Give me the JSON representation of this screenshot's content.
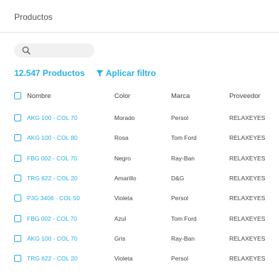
{
  "header": {
    "title": "Productos"
  },
  "search": {
    "placeholder": "",
    "value": ""
  },
  "summary": {
    "count_label": "12.547 Productos",
    "filter_label": "Aplicar filtro"
  },
  "table": {
    "columns": [
      "Nombre",
      "Color",
      "Marca",
      "Proveedor"
    ],
    "rows": [
      {
        "name": "AKG 100 - COL 70",
        "color": "Morado",
        "brand": "Persol",
        "supplier": "RELAXEYES"
      },
      {
        "name": "AKG 100 - COL 80",
        "color": "Rosa",
        "brand": "Tom Ford",
        "supplier": "RELAXEYES"
      },
      {
        "name": "FBG 002 - COL 70",
        "color": "Negro",
        "brand": "Ray-Ban",
        "supplier": "RELAXEYES"
      },
      {
        "name": "TRG 622 - COL 20",
        "color": "Amarillo",
        "brand": "D&G",
        "supplier": "RELAXEYES"
      },
      {
        "name": "PJG  3406 - COL 50",
        "color": "Violeta",
        "brand": "Persol",
        "supplier": "RELAXEYES"
      },
      {
        "name": "FBG 002 - COL 70",
        "color": "Azul",
        "brand": "Tom Ford",
        "supplier": "RELAXEYES"
      },
      {
        "name": "AKG 100 - COL 70",
        "color": "Gris",
        "brand": "Ray-Ban",
        "supplier": "RELAXEYES"
      },
      {
        "name": "TRG 622 - COL 20",
        "color": "Violeta",
        "brand": "Persol",
        "supplier": "RELAXEYES"
      }
    ]
  },
  "colors": {
    "accent": "#2ab0e4",
    "search_bg": "#f1f1f2",
    "divider": "#e3e3e3"
  },
  "icons": {
    "search": "search-icon",
    "filter": "filter-icon"
  }
}
